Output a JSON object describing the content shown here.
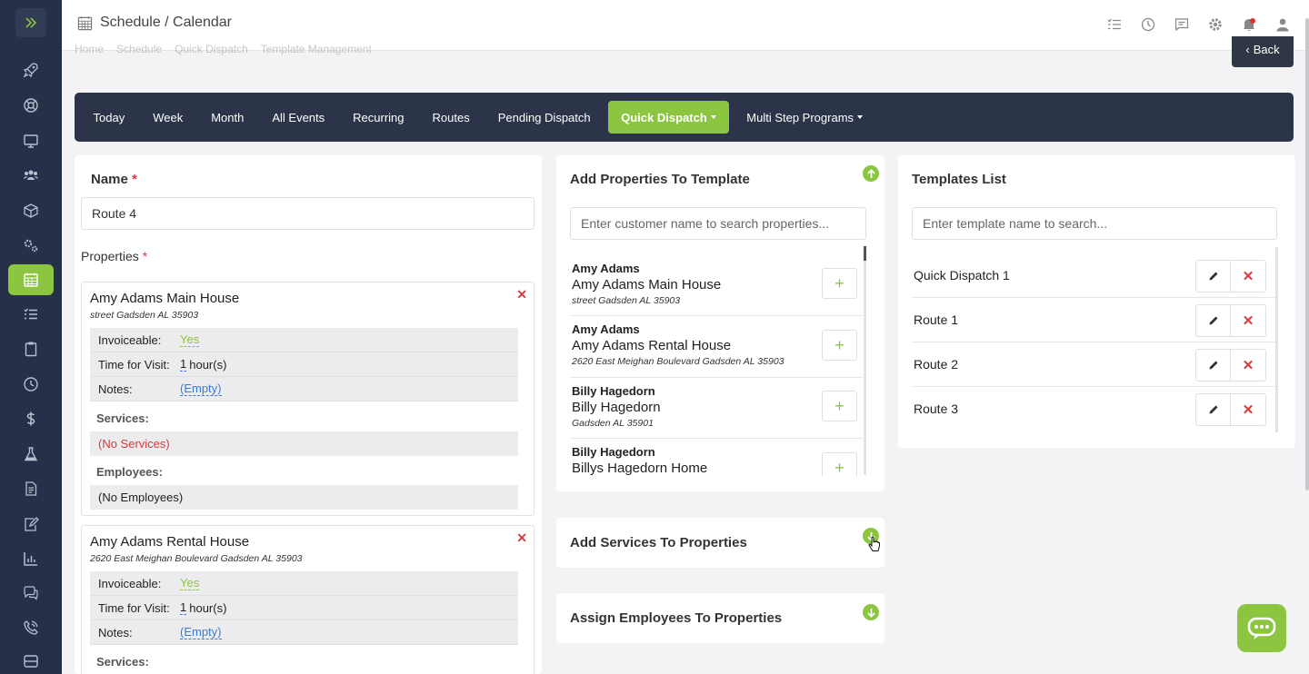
{
  "app": {
    "page_title": "Schedule / Calendar",
    "breadcrumb": [
      "Home",
      "Schedule",
      "Quick Dispatch",
      "Template Management"
    ],
    "back_label": "Back"
  },
  "sidebar": {
    "items": [
      "rocket-icon",
      "support-icon",
      "monitor-icon",
      "users-icon",
      "box-icon",
      "gears-icon",
      "calendar-icon",
      "list-icon",
      "clipboard-icon",
      "clock-icon",
      "dollar-icon",
      "flask-icon",
      "document-icon",
      "edit-document-icon",
      "chart-icon",
      "chat-icon",
      "phone-icon",
      "storage-icon"
    ],
    "active": "calendar-icon",
    "accent": "#8cc540",
    "bg": "#263049"
  },
  "nav": {
    "tabs": [
      {
        "label": "Today"
      },
      {
        "label": "Week"
      },
      {
        "label": "Month"
      },
      {
        "label": "All Events"
      },
      {
        "label": "Recurring"
      },
      {
        "label": "Routes"
      },
      {
        "label": "Pending Dispatch"
      },
      {
        "label": "Quick Dispatch",
        "active": true
      },
      {
        "label": "Multi Step Programs"
      }
    ]
  },
  "form": {
    "name_label": "Name",
    "required_mark": "*",
    "name_value": "Route 4",
    "properties_label": "Properties",
    "properties": [
      {
        "title": "Amy Adams Main House",
        "address": "street Gadsden AL 35903",
        "invoiceable_label": "Invoiceable:",
        "invoiceable": "Yes",
        "time_label": "Time for Visit:",
        "time_value": "1",
        "time_unit": "hour(s)",
        "notes_label": "Notes:",
        "notes": "(Empty)",
        "services_label": "Services:",
        "services": "(No Services)",
        "employees_label": "Employees:",
        "employees": "(No Employees)"
      },
      {
        "title": "Amy Adams Rental House",
        "address": "2620 East Meighan Boulevard Gadsden AL 35903",
        "invoiceable_label": "Invoiceable:",
        "invoiceable": "Yes",
        "time_label": "Time for Visit:",
        "time_value": "1",
        "time_unit": "hour(s)",
        "notes_label": "Notes:",
        "notes": "(Empty)",
        "services_label": "Services:"
      }
    ]
  },
  "add_properties": {
    "title": "Add Properties To Template",
    "search_placeholder": "Enter customer name to search properties...",
    "customers": [
      {
        "customer": "Amy Adams",
        "property": "Amy Adams Main House",
        "address": "street Gadsden AL 35903"
      },
      {
        "customer": "Amy Adams",
        "property": "Amy Adams Rental House",
        "address": "2620 East Meighan Boulevard Gadsden AL 35903"
      },
      {
        "customer": "Billy Hagedorn",
        "property": "Billy Hagedorn",
        "address": "Gadsden AL 35901"
      },
      {
        "customer": "Billy Hagedorn",
        "property": "Billys Hagedorn Home",
        "address": ""
      }
    ],
    "add_symbol": "+"
  },
  "add_services": {
    "title": "Add Services To Properties"
  },
  "assign_employees": {
    "title": "Assign Employees To Properties"
  },
  "templates": {
    "title": "Templates List",
    "search_placeholder": "Enter template name to search...",
    "items": [
      "Quick Dispatch 1",
      "Route 1",
      "Route 2",
      "Route 3"
    ],
    "delete_symbol": "✕"
  }
}
